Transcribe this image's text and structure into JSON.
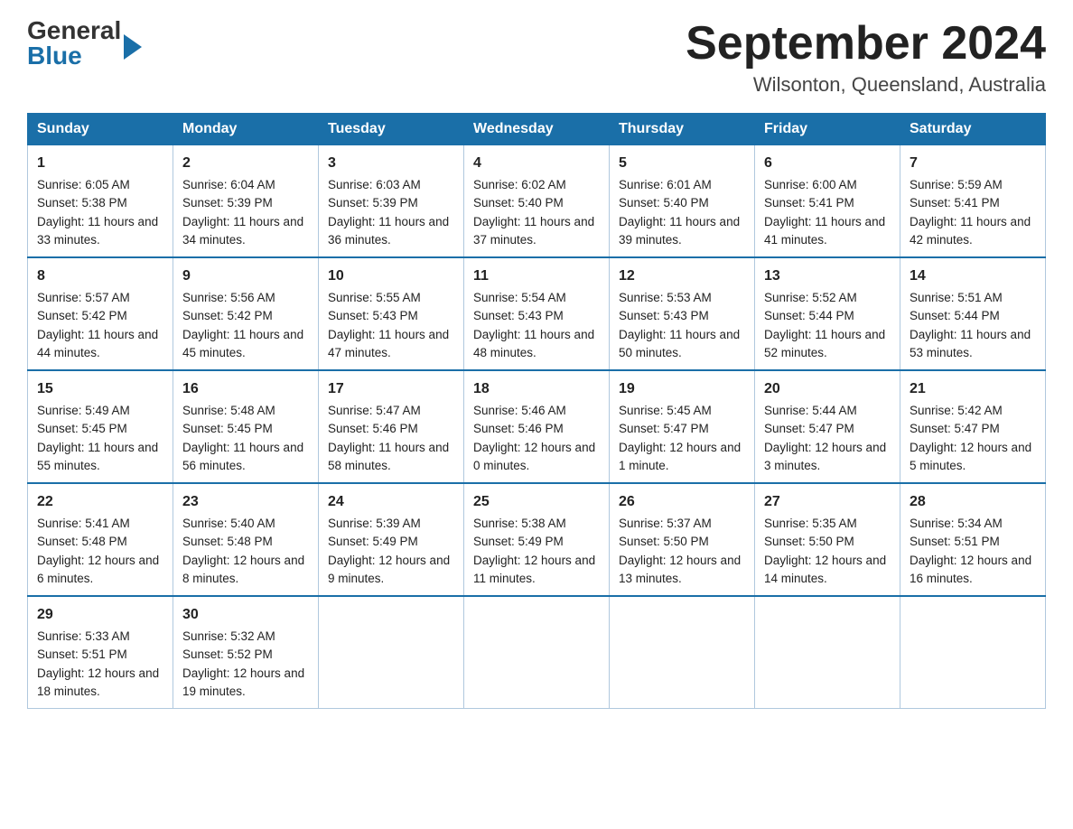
{
  "header": {
    "logo": {
      "general": "General",
      "blue": "Blue"
    },
    "title": "September 2024",
    "location": "Wilsonton, Queensland, Australia"
  },
  "calendar": {
    "headers": [
      "Sunday",
      "Monday",
      "Tuesday",
      "Wednesday",
      "Thursday",
      "Friday",
      "Saturday"
    ],
    "weeks": [
      [
        {
          "day": "1",
          "sunrise": "Sunrise: 6:05 AM",
          "sunset": "Sunset: 5:38 PM",
          "daylight": "Daylight: 11 hours and 33 minutes."
        },
        {
          "day": "2",
          "sunrise": "Sunrise: 6:04 AM",
          "sunset": "Sunset: 5:39 PM",
          "daylight": "Daylight: 11 hours and 34 minutes."
        },
        {
          "day": "3",
          "sunrise": "Sunrise: 6:03 AM",
          "sunset": "Sunset: 5:39 PM",
          "daylight": "Daylight: 11 hours and 36 minutes."
        },
        {
          "day": "4",
          "sunrise": "Sunrise: 6:02 AM",
          "sunset": "Sunset: 5:40 PM",
          "daylight": "Daylight: 11 hours and 37 minutes."
        },
        {
          "day": "5",
          "sunrise": "Sunrise: 6:01 AM",
          "sunset": "Sunset: 5:40 PM",
          "daylight": "Daylight: 11 hours and 39 minutes."
        },
        {
          "day": "6",
          "sunrise": "Sunrise: 6:00 AM",
          "sunset": "Sunset: 5:41 PM",
          "daylight": "Daylight: 11 hours and 41 minutes."
        },
        {
          "day": "7",
          "sunrise": "Sunrise: 5:59 AM",
          "sunset": "Sunset: 5:41 PM",
          "daylight": "Daylight: 11 hours and 42 minutes."
        }
      ],
      [
        {
          "day": "8",
          "sunrise": "Sunrise: 5:57 AM",
          "sunset": "Sunset: 5:42 PM",
          "daylight": "Daylight: 11 hours and 44 minutes."
        },
        {
          "day": "9",
          "sunrise": "Sunrise: 5:56 AM",
          "sunset": "Sunset: 5:42 PM",
          "daylight": "Daylight: 11 hours and 45 minutes."
        },
        {
          "day": "10",
          "sunrise": "Sunrise: 5:55 AM",
          "sunset": "Sunset: 5:43 PM",
          "daylight": "Daylight: 11 hours and 47 minutes."
        },
        {
          "day": "11",
          "sunrise": "Sunrise: 5:54 AM",
          "sunset": "Sunset: 5:43 PM",
          "daylight": "Daylight: 11 hours and 48 minutes."
        },
        {
          "day": "12",
          "sunrise": "Sunrise: 5:53 AM",
          "sunset": "Sunset: 5:43 PM",
          "daylight": "Daylight: 11 hours and 50 minutes."
        },
        {
          "day": "13",
          "sunrise": "Sunrise: 5:52 AM",
          "sunset": "Sunset: 5:44 PM",
          "daylight": "Daylight: 11 hours and 52 minutes."
        },
        {
          "day": "14",
          "sunrise": "Sunrise: 5:51 AM",
          "sunset": "Sunset: 5:44 PM",
          "daylight": "Daylight: 11 hours and 53 minutes."
        }
      ],
      [
        {
          "day": "15",
          "sunrise": "Sunrise: 5:49 AM",
          "sunset": "Sunset: 5:45 PM",
          "daylight": "Daylight: 11 hours and 55 minutes."
        },
        {
          "day": "16",
          "sunrise": "Sunrise: 5:48 AM",
          "sunset": "Sunset: 5:45 PM",
          "daylight": "Daylight: 11 hours and 56 minutes."
        },
        {
          "day": "17",
          "sunrise": "Sunrise: 5:47 AM",
          "sunset": "Sunset: 5:46 PM",
          "daylight": "Daylight: 11 hours and 58 minutes."
        },
        {
          "day": "18",
          "sunrise": "Sunrise: 5:46 AM",
          "sunset": "Sunset: 5:46 PM",
          "daylight": "Daylight: 12 hours and 0 minutes."
        },
        {
          "day": "19",
          "sunrise": "Sunrise: 5:45 AM",
          "sunset": "Sunset: 5:47 PM",
          "daylight": "Daylight: 12 hours and 1 minute."
        },
        {
          "day": "20",
          "sunrise": "Sunrise: 5:44 AM",
          "sunset": "Sunset: 5:47 PM",
          "daylight": "Daylight: 12 hours and 3 minutes."
        },
        {
          "day": "21",
          "sunrise": "Sunrise: 5:42 AM",
          "sunset": "Sunset: 5:47 PM",
          "daylight": "Daylight: 12 hours and 5 minutes."
        }
      ],
      [
        {
          "day": "22",
          "sunrise": "Sunrise: 5:41 AM",
          "sunset": "Sunset: 5:48 PM",
          "daylight": "Daylight: 12 hours and 6 minutes."
        },
        {
          "day": "23",
          "sunrise": "Sunrise: 5:40 AM",
          "sunset": "Sunset: 5:48 PM",
          "daylight": "Daylight: 12 hours and 8 minutes."
        },
        {
          "day": "24",
          "sunrise": "Sunrise: 5:39 AM",
          "sunset": "Sunset: 5:49 PM",
          "daylight": "Daylight: 12 hours and 9 minutes."
        },
        {
          "day": "25",
          "sunrise": "Sunrise: 5:38 AM",
          "sunset": "Sunset: 5:49 PM",
          "daylight": "Daylight: 12 hours and 11 minutes."
        },
        {
          "day": "26",
          "sunrise": "Sunrise: 5:37 AM",
          "sunset": "Sunset: 5:50 PM",
          "daylight": "Daylight: 12 hours and 13 minutes."
        },
        {
          "day": "27",
          "sunrise": "Sunrise: 5:35 AM",
          "sunset": "Sunset: 5:50 PM",
          "daylight": "Daylight: 12 hours and 14 minutes."
        },
        {
          "day": "28",
          "sunrise": "Sunrise: 5:34 AM",
          "sunset": "Sunset: 5:51 PM",
          "daylight": "Daylight: 12 hours and 16 minutes."
        }
      ],
      [
        {
          "day": "29",
          "sunrise": "Sunrise: 5:33 AM",
          "sunset": "Sunset: 5:51 PM",
          "daylight": "Daylight: 12 hours and 18 minutes."
        },
        {
          "day": "30",
          "sunrise": "Sunrise: 5:32 AM",
          "sunset": "Sunset: 5:52 PM",
          "daylight": "Daylight: 12 hours and 19 minutes."
        },
        {
          "day": "",
          "sunrise": "",
          "sunset": "",
          "daylight": ""
        },
        {
          "day": "",
          "sunrise": "",
          "sunset": "",
          "daylight": ""
        },
        {
          "day": "",
          "sunrise": "",
          "sunset": "",
          "daylight": ""
        },
        {
          "day": "",
          "sunrise": "",
          "sunset": "",
          "daylight": ""
        },
        {
          "day": "",
          "sunrise": "",
          "sunset": "",
          "daylight": ""
        }
      ]
    ]
  }
}
